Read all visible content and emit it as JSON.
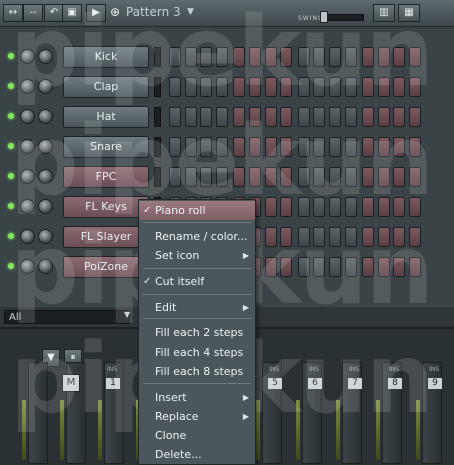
{
  "toolbar": {
    "pattern_label": "Pattern 3",
    "swing_label": "SWING",
    "btn_dashes": "--",
    "btn_undo": "↶"
  },
  "channels": [
    {
      "name": "Kick",
      "highlight": false
    },
    {
      "name": "Clap",
      "highlight": false
    },
    {
      "name": "Hat",
      "highlight": false
    },
    {
      "name": "Snare",
      "highlight": false
    },
    {
      "name": "FPC",
      "highlight": true
    },
    {
      "name": "FL Keys",
      "highlight": true
    },
    {
      "name": "FL Slayer",
      "highlight": true
    },
    {
      "name": "PoiZone",
      "highlight": true
    }
  ],
  "filter": {
    "value": "All"
  },
  "mixer": {
    "insert_label": "INS",
    "insert_numbers": [
      "1",
      "5",
      "6",
      "7",
      "8",
      "9"
    ]
  },
  "watermark": {
    "text": "pipekun"
  },
  "context_menu": {
    "items": [
      {
        "label": "Piano roll",
        "highlight": true
      },
      {
        "label": "Rename / color..."
      },
      {
        "label": "Set icon",
        "submenu": true
      },
      {
        "label": "Cut itself",
        "checked": true
      },
      {
        "label": "Edit",
        "submenu": true
      },
      {
        "label": "Fill each 2 steps"
      },
      {
        "label": "Fill each 4 steps"
      },
      {
        "label": "Fill each 8 steps"
      },
      {
        "label": "Insert",
        "submenu": true
      },
      {
        "label": "Replace",
        "submenu": true
      },
      {
        "label": "Clone"
      },
      {
        "label": "Delete..."
      }
    ]
  }
}
